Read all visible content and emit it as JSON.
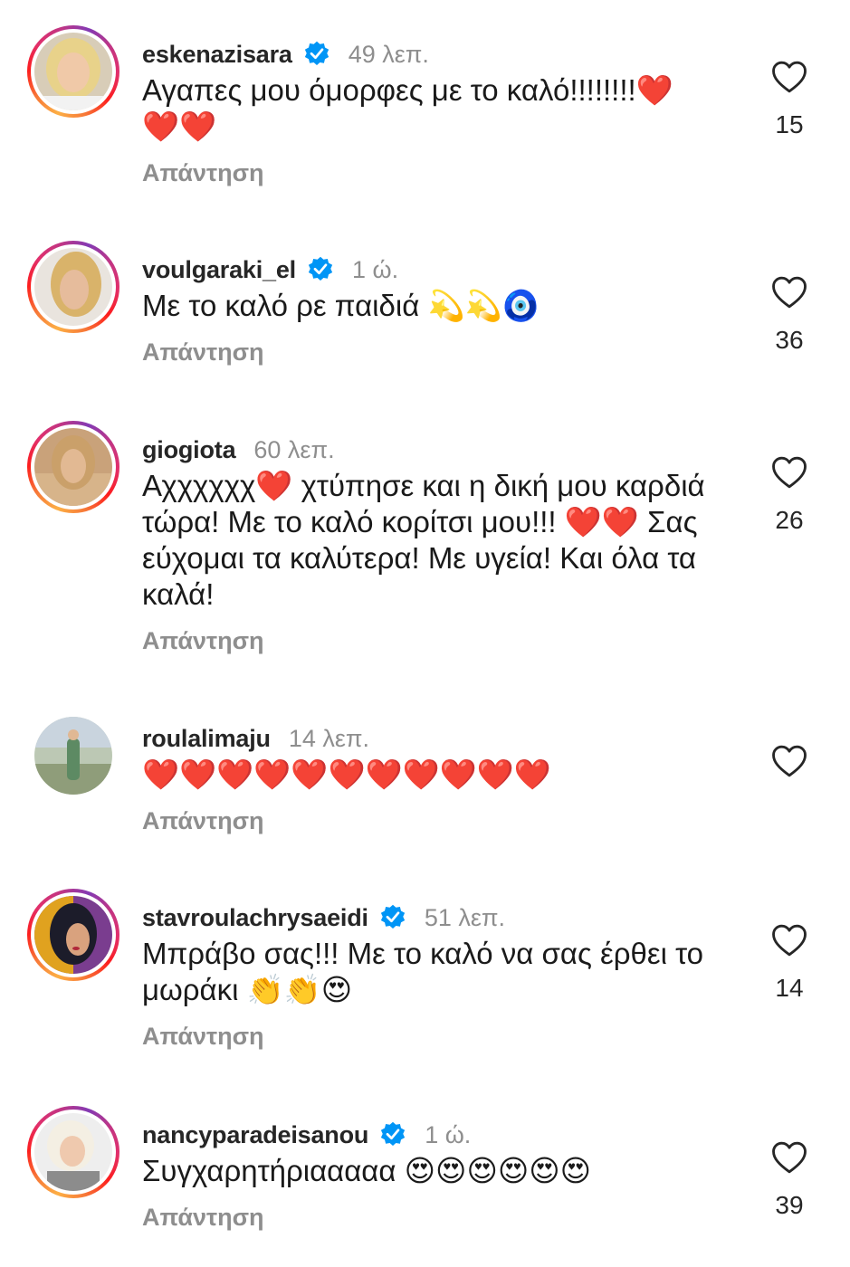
{
  "comments": [
    {
      "username": "eskenazisara",
      "verified": true,
      "time": "49 λεπ.",
      "text": "Αγαπες μου όμορφες με το καλό!!!!!!!!❤️\n❤️❤️",
      "reply_label": "Απάντηση",
      "likes": "15",
      "has_story_ring": true
    },
    {
      "username": "voulgaraki_el",
      "verified": true,
      "time": "1 ώ.",
      "text": "Με το καλό ρε παιδιά 💫💫🧿",
      "reply_label": "Απάντηση",
      "likes": "36",
      "has_story_ring": true
    },
    {
      "username": "giogiota",
      "verified": false,
      "time": "60 λεπ.",
      "text": "Αχχχχχχ❤️ χτύπησε και η δική μου καρδιά τώρα! Με το καλό κορίτσι μου!!! ❤️❤️ Σας εύχομαι τα καλύτερα! Με υγεία! Και όλα τα καλά!",
      "reply_label": "Απάντηση",
      "likes": "26",
      "has_story_ring": true
    },
    {
      "username": "roulalimaju",
      "verified": false,
      "time": "14 λεπ.",
      "text": "❤️❤️❤️❤️❤️❤️❤️❤️❤️❤️❤️",
      "reply_label": "Απάντηση",
      "likes": "",
      "has_story_ring": false
    },
    {
      "username": "stavroulachrysaeidi",
      "verified": true,
      "time": "51 λεπ.",
      "text": "Μπράβο σας!!! Με το καλό να σας έρθει το μωράκι 👏👏😍",
      "reply_label": "Απάντηση",
      "likes": "14",
      "has_story_ring": true
    },
    {
      "username": "nancyparadeisanou",
      "verified": true,
      "time": "1 ώ.",
      "text": "Συγχαρητήριααααα 😍😍😍😍😍😍",
      "reply_label": "Απάντηση",
      "likes": "39",
      "has_story_ring": true
    }
  ],
  "colors": {
    "verified_blue": "#0095f6",
    "secondary_text": "#8e8e8e"
  },
  "icons": {
    "like": "heart-outline-icon",
    "verified": "verified-badge-icon"
  }
}
